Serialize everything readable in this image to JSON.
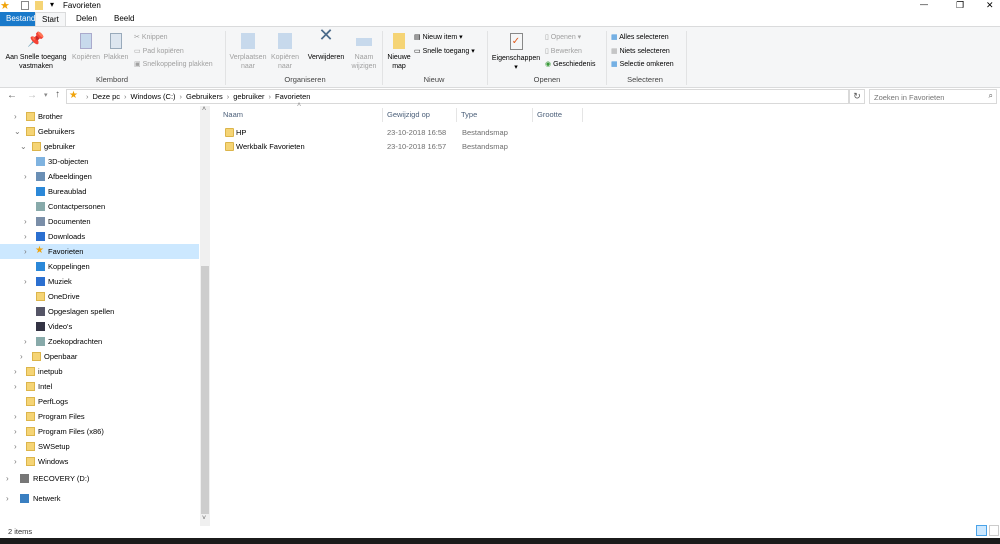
{
  "window": {
    "title": "Favorieten",
    "min": "—",
    "restore": "❐",
    "close": "✕"
  },
  "ribbon_tabs": [
    "Bestand",
    "Start",
    "Delen",
    "Beeld"
  ],
  "ribbon": {
    "pin": "Aan Snelle toegang vastmaken",
    "copy": "Kopiëren",
    "paste": "Plakken",
    "cut": "Knippen",
    "copy_path": "Pad kopiëren",
    "paste_shortcut": "Snelkoppeling plakken",
    "group_clipboard": "Klembord",
    "move_to": "Verplaatsen naar",
    "copy_to": "Kopiëren naar",
    "delete": "Verwijderen",
    "rename": "Naam wijzigen",
    "group_organize": "Organiseren",
    "new_folder": "Nieuwe map",
    "new_item": "Nieuw item",
    "easy_access": "Snelle toegang",
    "group_new": "Nieuw",
    "properties": "Eigenschappen",
    "open": "Openen",
    "edit": "Bewerken",
    "history": "Geschiedenis",
    "group_open": "Openen",
    "select_all": "Alles selecteren",
    "select_none": "Niets selecteren",
    "invert": "Selectie omkeren",
    "group_select": "Selecteren"
  },
  "address": {
    "crumbs": [
      "Deze pc",
      "Windows (C:)",
      "Gebruikers",
      "gebruiker",
      "Favorieten"
    ],
    "search_placeholder": "Zoeken in Favorieten"
  },
  "tree": [
    {
      "label": "Brother",
      "level": 1,
      "chevron": ">",
      "icon": "folder"
    },
    {
      "label": "Gebruikers",
      "level": 1,
      "chevron": "v",
      "icon": "folder"
    },
    {
      "label": "gebruiker",
      "level": 2,
      "chevron": "v",
      "icon": "folder"
    },
    {
      "label": "3D-objecten",
      "level": 3,
      "chevron": "",
      "icon": "3d-objects"
    },
    {
      "label": "Afbeeldingen",
      "level": 3,
      "chevron": ">",
      "icon": "pictures"
    },
    {
      "label": "Bureaublad",
      "level": 3,
      "chevron": "",
      "icon": "desktop"
    },
    {
      "label": "Contactpersonen",
      "level": 3,
      "chevron": "",
      "icon": "contacts"
    },
    {
      "label": "Documenten",
      "level": 3,
      "chevron": ">",
      "icon": "documents"
    },
    {
      "label": "Downloads",
      "level": 3,
      "chevron": ">",
      "icon": "downloads"
    },
    {
      "label": "Favorieten",
      "level": 3,
      "chevron": ">",
      "icon": "star",
      "selected": true
    },
    {
      "label": "Koppelingen",
      "level": 3,
      "chevron": "",
      "icon": "links"
    },
    {
      "label": "Muziek",
      "level": 3,
      "chevron": ">",
      "icon": "music"
    },
    {
      "label": "OneDrive",
      "level": 3,
      "chevron": "",
      "icon": "folder"
    },
    {
      "label": "Opgeslagen spellen",
      "level": 3,
      "chevron": "",
      "icon": "saved-games"
    },
    {
      "label": "Video's",
      "level": 3,
      "chevron": "",
      "icon": "videos"
    },
    {
      "label": "Zoekopdrachten",
      "level": 3,
      "chevron": ">",
      "icon": "searches"
    },
    {
      "label": "Openbaar",
      "level": 2,
      "chevron": ">",
      "icon": "folder"
    },
    {
      "label": "inetpub",
      "level": 1,
      "chevron": ">",
      "icon": "folder"
    },
    {
      "label": "Intel",
      "level": 1,
      "chevron": ">",
      "icon": "folder"
    },
    {
      "label": "PerfLogs",
      "level": 1,
      "chevron": "",
      "icon": "folder"
    },
    {
      "label": "Program Files",
      "level": 1,
      "chevron": ">",
      "icon": "folder"
    },
    {
      "label": "Program Files (x86)",
      "level": 1,
      "chevron": ">",
      "icon": "folder"
    },
    {
      "label": "SWSetup",
      "level": 1,
      "chevron": ">",
      "icon": "folder"
    },
    {
      "label": "Windows",
      "level": 1,
      "chevron": ">",
      "icon": "folder"
    },
    {
      "label": "RECOVERY (D:)",
      "level": 0,
      "chevron": ">",
      "icon": "drive"
    },
    {
      "label": "Netwerk",
      "level": 0,
      "chevron": ">",
      "icon": "network"
    }
  ],
  "columns": [
    "Naam",
    "Gewijzigd op",
    "Type",
    "Grootte"
  ],
  "files": [
    {
      "name": "HP",
      "modified": "23-10-2018 16:58",
      "type": "Bestandsmap",
      "size": ""
    },
    {
      "name": "Werkbalk Favorieten",
      "modified": "23-10-2018 16:57",
      "type": "Bestandsmap",
      "size": ""
    }
  ],
  "status": {
    "count": "2 items"
  },
  "colors": {
    "accent": "#1979ca",
    "selection": "#cce8ff",
    "folder": "#f5d475"
  }
}
